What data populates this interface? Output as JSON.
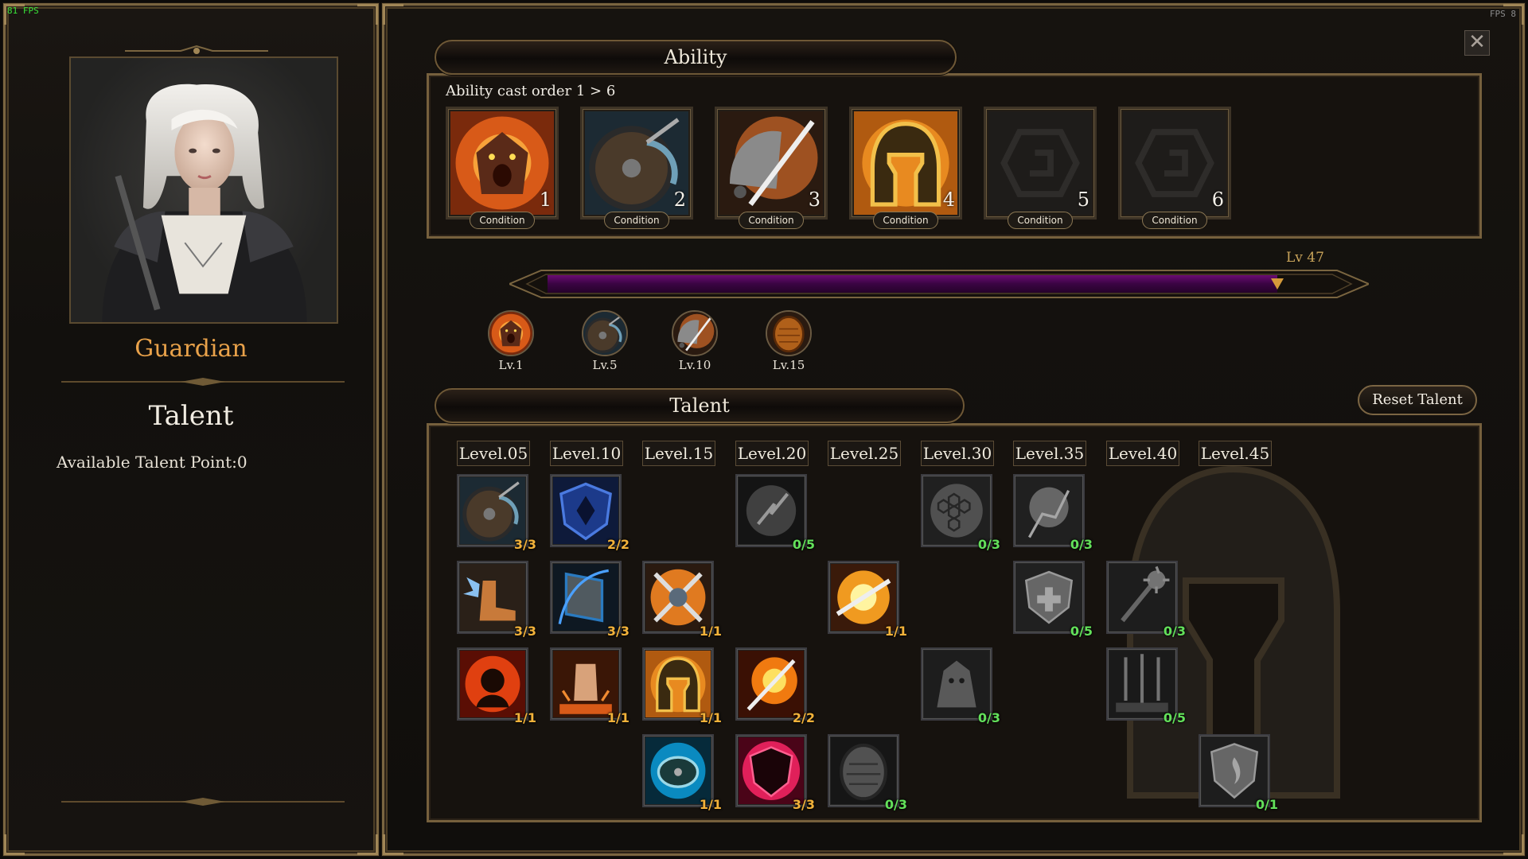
{
  "overlay": {
    "fps_left": "81 FPS",
    "fps_right": "FPS 8"
  },
  "character": {
    "class_name": "Guardian",
    "talent_heading": "Talent",
    "available_talent_points": "Available Talent Point:0"
  },
  "ability": {
    "header": "Ability",
    "cast_order_label": "Ability cast order 1 > 6",
    "slots": [
      {
        "number": "1",
        "condition_label": "Condition",
        "icon": "roaring-warrior-icon",
        "empty": false
      },
      {
        "number": "2",
        "condition_label": "Condition",
        "icon": "shield-bash-icon",
        "empty": false
      },
      {
        "number": "3",
        "condition_label": "Condition",
        "icon": "helm-strike-icon",
        "empty": false
      },
      {
        "number": "4",
        "condition_label": "Condition",
        "icon": "golden-helmet-icon",
        "empty": false
      },
      {
        "number": "5",
        "condition_label": "Condition",
        "icon": "empty-slot-icon",
        "empty": true
      },
      {
        "number": "6",
        "condition_label": "Condition",
        "icon": "empty-slot-icon",
        "empty": true
      }
    ],
    "level_indicator": "Lv 47",
    "xp_progress": 0.93,
    "milestones": [
      {
        "label": "Lv.1",
        "icon": "roaring-warrior-icon"
      },
      {
        "label": "Lv.5",
        "icon": "shield-bash-icon"
      },
      {
        "label": "Lv.10",
        "icon": "helm-strike-icon"
      },
      {
        "label": "Lv.15",
        "icon": "wooden-shield-icon"
      }
    ]
  },
  "talent": {
    "header": "Talent",
    "reset_label": "Reset Talent",
    "levels": [
      "Level.05",
      "Level.10",
      "Level.15",
      "Level.20",
      "Level.25",
      "Level.30",
      "Level.35",
      "Level.40",
      "Level.45"
    ],
    "nodes": [
      {
        "col": 0,
        "row": 0,
        "count": "3/3",
        "full": true,
        "icon": "shield-bash-icon"
      },
      {
        "col": 1,
        "row": 0,
        "count": "2/2",
        "full": true,
        "icon": "blue-shield-icon"
      },
      {
        "col": 3,
        "row": 0,
        "count": "0/5",
        "full": false,
        "icon": "cracked-shield-icon"
      },
      {
        "col": 5,
        "row": 0,
        "count": "0/3",
        "full": false,
        "icon": "hex-armor-icon"
      },
      {
        "col": 6,
        "row": 0,
        "count": "0/3",
        "full": false,
        "icon": "shatter-icon"
      },
      {
        "col": 0,
        "row": 1,
        "count": "3/3",
        "full": true,
        "icon": "winged-boot-icon"
      },
      {
        "col": 1,
        "row": 1,
        "count": "3/3",
        "full": true,
        "icon": "tower-shield-icon"
      },
      {
        "col": 2,
        "row": 1,
        "count": "1/1",
        "full": true,
        "icon": "crossed-swords-icon"
      },
      {
        "col": 4,
        "row": 1,
        "count": "1/1",
        "full": true,
        "icon": "sword-burst-icon"
      },
      {
        "col": 6,
        "row": 1,
        "count": "0/5",
        "full": false,
        "icon": "heal-shield-icon"
      },
      {
        "col": 7,
        "row": 1,
        "count": "0/3",
        "full": false,
        "icon": "spiked-mace-icon"
      },
      {
        "col": 0,
        "row": 2,
        "count": "1/1",
        "full": true,
        "icon": "rage-fist-icon"
      },
      {
        "col": 1,
        "row": 2,
        "count": "1/1",
        "full": true,
        "icon": "ground-punch-icon"
      },
      {
        "col": 2,
        "row": 2,
        "count": "1/1",
        "full": true,
        "icon": "golden-helmet-icon"
      },
      {
        "col": 3,
        "row": 2,
        "count": "2/2",
        "full": true,
        "icon": "flaming-sword-icon"
      },
      {
        "col": 5,
        "row": 2,
        "count": "0/3",
        "full": false,
        "icon": "berserker-icon"
      },
      {
        "col": 7,
        "row": 2,
        "count": "0/5",
        "full": false,
        "icon": "sword-rain-icon"
      },
      {
        "col": 2,
        "row": 3,
        "count": "1/1",
        "full": true,
        "icon": "vortex-shield-icon"
      },
      {
        "col": 3,
        "row": 3,
        "count": "3/3",
        "full": true,
        "icon": "crimson-shield-icon"
      },
      {
        "col": 4,
        "row": 3,
        "count": "0/3",
        "full": false,
        "icon": "wooden-shield-icon"
      },
      {
        "col": 8,
        "row": 3,
        "count": "0/1",
        "full": false,
        "icon": "fire-shield-icon"
      }
    ]
  },
  "close_icon": "close-icon"
}
